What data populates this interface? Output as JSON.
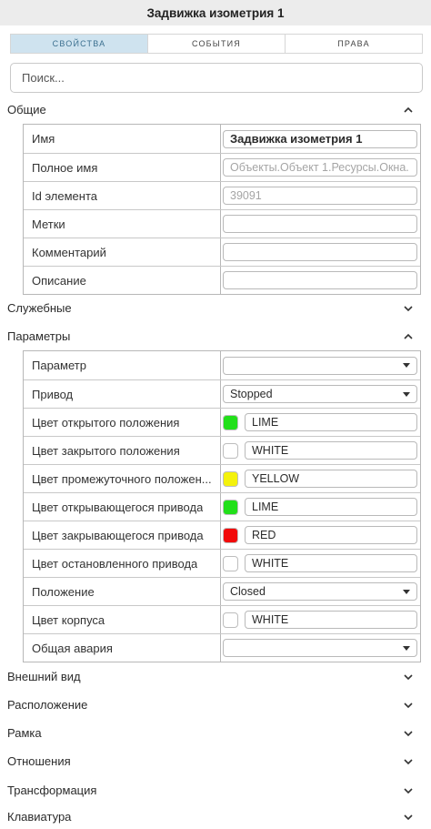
{
  "header": {
    "title": "Задвижка изометрия 1"
  },
  "tabs": [
    {
      "label": "СВОЙСТВА"
    },
    {
      "label": "СОБЫТИЯ"
    },
    {
      "label": "ПРАВА"
    }
  ],
  "search": {
    "placeholder": "Поиск...",
    "value": ""
  },
  "sections": {
    "general": {
      "title": "Общие",
      "expanded": true,
      "rows": [
        {
          "label": "Имя",
          "value": "Задвижка изометрия 1"
        },
        {
          "label": "Полное имя",
          "value": "Объекты.Объект 1.Ресурсы.Окна."
        },
        {
          "label": "Id элемента",
          "value": "39091"
        },
        {
          "label": "Метки",
          "value": ""
        },
        {
          "label": "Комментарий",
          "value": ""
        },
        {
          "label": "Описание",
          "value": ""
        }
      ]
    },
    "service": {
      "title": "Служебные",
      "expanded": false
    },
    "params": {
      "title": "Параметры",
      "expanded": true,
      "rows": [
        {
          "label": "Параметр",
          "value": ""
        },
        {
          "label": "Привод",
          "value": "Stopped"
        },
        {
          "label": "Цвет открытого положения",
          "value": "LIME",
          "color": "#22e01a"
        },
        {
          "label": "Цвет закрытого положения",
          "value": "WHITE",
          "color": "#ffffff"
        },
        {
          "label": "Цвет промежуточного положен...",
          "value": "YELLOW",
          "color": "#f4f20c"
        },
        {
          "label": "Цвет открывающегося привода",
          "value": "LIME",
          "color": "#22e01a"
        },
        {
          "label": "Цвет закрывающегося привода",
          "value": "RED",
          "color": "#f20a0a"
        },
        {
          "label": "Цвет остановленного привода",
          "value": "WHITE",
          "color": "#ffffff"
        },
        {
          "label": "Положение",
          "value": "Closed"
        },
        {
          "label": "Цвет корпуса",
          "value": "WHITE",
          "color": "#ffffff"
        },
        {
          "label": "Общая авария",
          "value": ""
        }
      ]
    },
    "appearance": {
      "title": "Внешний вид",
      "expanded": false
    },
    "placement": {
      "title": "Расположение",
      "expanded": false
    },
    "frame": {
      "title": "Рамка",
      "expanded": false
    },
    "relations": {
      "title": "Отношения",
      "expanded": false
    },
    "transform": {
      "title": "Трансформация",
      "expanded": false
    },
    "keyboard": {
      "title": "Клавиатура",
      "expanded": false
    }
  },
  "icons": {
    "expanded": "chevron-up-icon",
    "collapsed": "chevron-down-icon",
    "dropdown": "caret-down-icon"
  },
  "colors": {
    "tab_active_bg": "#cfe3ef",
    "tab_active_text": "#3b6f8f",
    "titlebar_bg": "#ececec"
  }
}
